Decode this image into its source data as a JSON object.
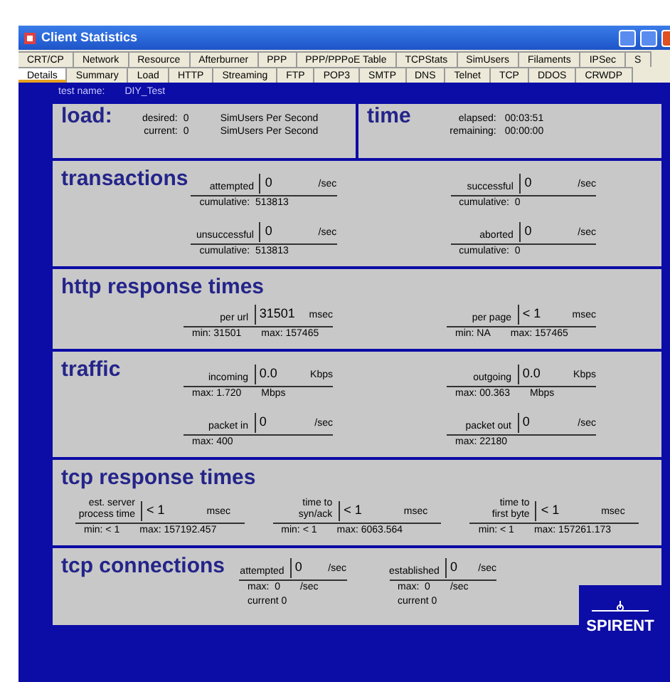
{
  "window": {
    "title": "Client Statistics"
  },
  "tabs_row1": [
    {
      "label": "CRT/CP",
      "selected": false
    },
    {
      "label": "Network",
      "selected": false
    },
    {
      "label": "Resource",
      "selected": false
    },
    {
      "label": "Afterburner",
      "selected": false
    },
    {
      "label": "PPP",
      "selected": false
    },
    {
      "label": "PPP/PPPoE Table",
      "selected": false
    },
    {
      "label": "TCPStats",
      "selected": false
    },
    {
      "label": "SimUsers",
      "selected": false
    },
    {
      "label": "Filaments",
      "selected": false
    },
    {
      "label": "IPSec",
      "selected": false
    },
    {
      "label": "S",
      "selected": false
    }
  ],
  "tabs_row2": [
    {
      "label": "Details",
      "selected": true
    },
    {
      "label": "Summary",
      "selected": false
    },
    {
      "label": "Load",
      "selected": false
    },
    {
      "label": "HTTP",
      "selected": false
    },
    {
      "label": "Streaming",
      "selected": false
    },
    {
      "label": "FTP",
      "selected": false
    },
    {
      "label": "POP3",
      "selected": false
    },
    {
      "label": "SMTP",
      "selected": false
    },
    {
      "label": "DNS",
      "selected": false
    },
    {
      "label": "Telnet",
      "selected": false
    },
    {
      "label": "TCP",
      "selected": false
    },
    {
      "label": "DDOS",
      "selected": false
    },
    {
      "label": "CRWDP",
      "selected": false
    }
  ],
  "test_name": {
    "label": "test name:",
    "value": "DIY_Test"
  },
  "load": {
    "title": "load:",
    "rows": [
      {
        "label": "desired:",
        "value": "0",
        "unit": "SimUsers Per Second"
      },
      {
        "label": "current:",
        "value": "0",
        "unit": "SimUsers Per Second"
      }
    ]
  },
  "time": {
    "title": "time",
    "rows": [
      {
        "label": "elapsed:",
        "value": "00:03:51"
      },
      {
        "label": "remaining:",
        "value": "00:00:00"
      }
    ]
  },
  "transactions": {
    "title": "transactions",
    "metrics": [
      {
        "label": [
          "attempted"
        ],
        "value": "0",
        "unit": "/sec",
        "notes": [
          [
            "cumulative:  513813"
          ]
        ]
      },
      {
        "label": [
          "successful"
        ],
        "value": "0",
        "unit": "/sec",
        "notes": [
          [
            "cumulative:  0"
          ]
        ]
      },
      {
        "label": [
          "unsuccessful"
        ],
        "value": "0",
        "unit": "/sec",
        "notes": [
          [
            "cumulative:  513813"
          ]
        ]
      },
      {
        "label": [
          "aborted"
        ],
        "value": "0",
        "unit": "/sec",
        "notes": [
          [
            "cumulative:  0"
          ]
        ]
      }
    ]
  },
  "http_response_times": {
    "title": "http response times",
    "metrics": [
      {
        "label": [
          "per url"
        ],
        "value": "31501",
        "unit": "msec",
        "notes": [
          [
            "min: 31501",
            "max: 157465"
          ]
        ]
      },
      {
        "label": [
          "per page"
        ],
        "value": "< 1",
        "unit": "msec",
        "notes": [
          [
            "min: NA",
            "max: 157465"
          ]
        ]
      }
    ]
  },
  "traffic": {
    "title": "traffic",
    "metrics": [
      {
        "label": [
          "incoming"
        ],
        "value": "0.0",
        "unit": "Kbps",
        "notes": [
          [
            "max: 1.720",
            "Mbps"
          ]
        ]
      },
      {
        "label": [
          "outgoing"
        ],
        "value": "0.0",
        "unit": "Kbps",
        "notes": [
          [
            "max: 00.363",
            "Mbps"
          ]
        ]
      },
      {
        "label": [
          "packet in"
        ],
        "value": "0",
        "unit": "/sec",
        "notes": [
          [
            "max: 400"
          ]
        ]
      },
      {
        "label": [
          "packet out"
        ],
        "value": "0",
        "unit": "/sec",
        "notes": [
          [
            "max: 22180"
          ]
        ]
      }
    ]
  },
  "tcp_response_times": {
    "title": "tcp response times",
    "metrics": [
      {
        "label": [
          "est. server",
          "process time"
        ],
        "value": "< 1",
        "unit": "msec",
        "notes": [
          [
            "min: < 1",
            "max: 157192.457"
          ]
        ]
      },
      {
        "label": [
          "time to",
          "syn/ack"
        ],
        "value": "< 1",
        "unit": "msec",
        "notes": [
          [
            "min: < 1",
            "max: 6063.564"
          ]
        ]
      },
      {
        "label": [
          "time to",
          "first byte"
        ],
        "value": "< 1",
        "unit": "msec",
        "notes": [
          [
            "min: < 1",
            "max: 157261.173"
          ]
        ]
      }
    ]
  },
  "tcp_connections": {
    "title": "tcp connections",
    "metrics": [
      {
        "label": [
          "attempted"
        ],
        "value": "0",
        "unit": "/sec",
        "notes": [
          [
            "max:  0",
            "/sec"
          ],
          [
            "current 0"
          ]
        ]
      },
      {
        "label": [
          "established"
        ],
        "value": "0",
        "unit": "/sec",
        "notes": [
          [
            "max:  0",
            "/sec"
          ],
          [
            "current 0"
          ]
        ]
      }
    ]
  },
  "logo": {
    "text": "SPIRENT"
  }
}
